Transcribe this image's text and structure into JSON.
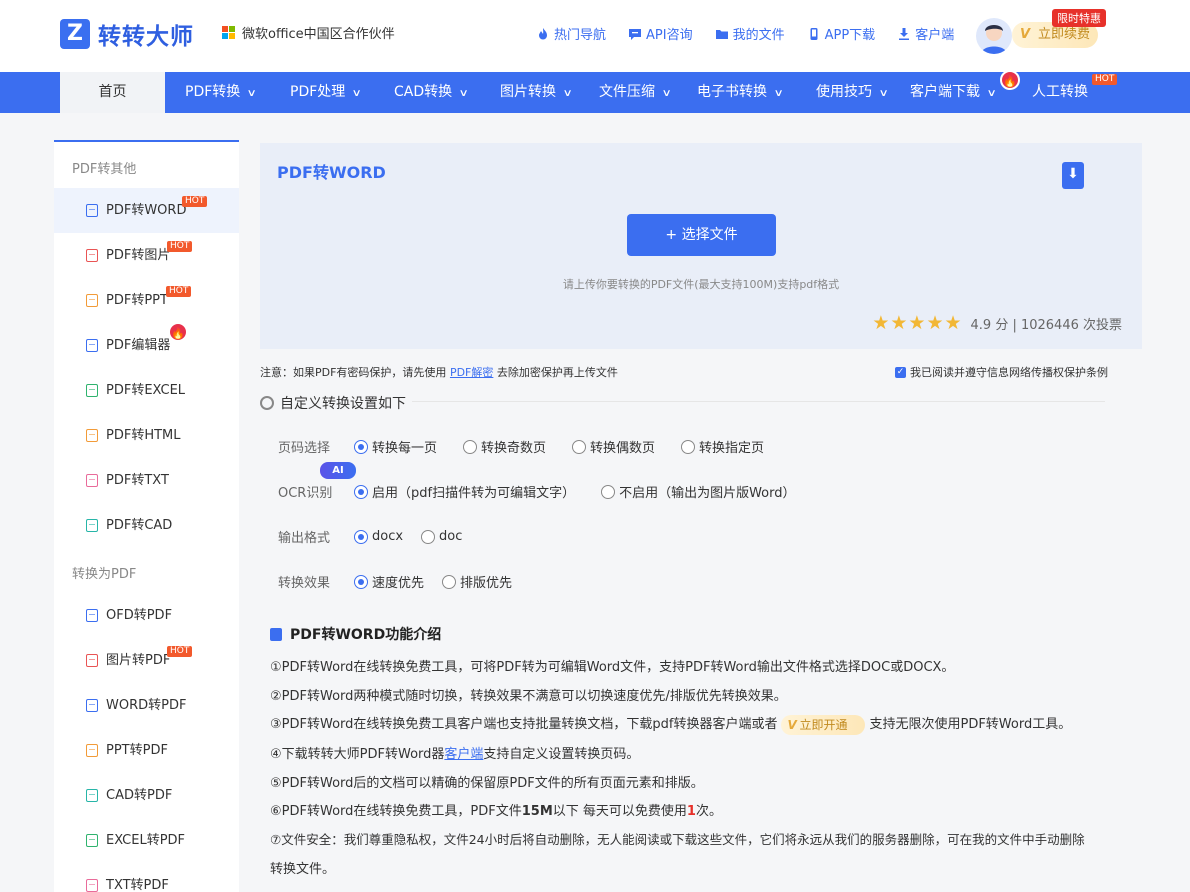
{
  "header": {
    "logo_text": "转转大师",
    "logo_mark": "Z",
    "partner_text": "微软office中国区合作伙伴",
    "links": [
      {
        "label": "热门导航",
        "icon": "fire-icon"
      },
      {
        "label": "API咨询",
        "icon": "chat-icon"
      },
      {
        "label": "我的文件",
        "icon": "folder-icon"
      },
      {
        "label": "APP下载",
        "icon": "phone-icon"
      },
      {
        "label": "客户端",
        "icon": "download-icon"
      }
    ],
    "renew_label": "立即续费",
    "limit_badge": "限时特惠"
  },
  "nav": {
    "home": "首页",
    "items": [
      {
        "label": "PDF转换"
      },
      {
        "label": "PDF处理"
      },
      {
        "label": "CAD转换"
      },
      {
        "label": "图片转换"
      },
      {
        "label": "文件压缩"
      },
      {
        "label": "电子书转换"
      },
      {
        "label": "使用技巧"
      },
      {
        "label": "客户端下载"
      },
      {
        "label": "人工转换"
      }
    ],
    "hot": "HOT"
  },
  "sidebar": {
    "group1": "PDF转其他",
    "group2": "转换为PDF",
    "items1": [
      {
        "label": "PDF转WORD",
        "badge": "HOT"
      },
      {
        "label": "PDF转图片",
        "badge": "HOT"
      },
      {
        "label": "PDF转PPT",
        "badge": "HOT"
      },
      {
        "label": "PDF编辑器",
        "badge": ""
      },
      {
        "label": "PDF转EXCEL",
        "badge": ""
      },
      {
        "label": "PDF转HTML",
        "badge": ""
      },
      {
        "label": "PDF转TXT",
        "badge": ""
      },
      {
        "label": "PDF转CAD",
        "badge": ""
      }
    ],
    "items2": [
      {
        "label": "OFD转PDF",
        "badge": ""
      },
      {
        "label": "图片转PDF",
        "badge": "HOT"
      },
      {
        "label": "WORD转PDF",
        "badge": ""
      },
      {
        "label": "PPT转PDF",
        "badge": ""
      },
      {
        "label": "CAD转PDF",
        "badge": ""
      },
      {
        "label": "EXCEL转PDF",
        "badge": ""
      },
      {
        "label": "TXT转PDF",
        "badge": ""
      }
    ]
  },
  "upload": {
    "title": "PDF转WORD",
    "choose_label": "+ 选择文件",
    "hint": "请上传你要转换的PDF文件(最大支持100M)支持pdf格式",
    "stars": "★★★★★",
    "score": "4.9 分 | 1026446 次投票",
    "rating_value": 4.9
  },
  "note": {
    "prefix": "注意：如果PDF有密码保护，请先使用",
    "link": "PDF解密",
    "suffix": "去除加密保护再上传文件",
    "agree": "我已阅读并遵守信息网络传播权保护条例",
    "agree_checked": true
  },
  "settings": {
    "title": "自定义转换设置如下",
    "rows": [
      {
        "label": "页码选择",
        "options": [
          "转换每一页",
          "转换奇数页",
          "转换偶数页",
          "转换指定页"
        ],
        "selected": 0
      },
      {
        "label": "OCR识别",
        "options": [
          "启用（pdf扫描件转为可编辑文字）",
          "不启用（输出为图片版Word）"
        ],
        "selected": 0
      },
      {
        "label": "输出格式",
        "options": [
          "docx",
          "doc"
        ],
        "selected": 0
      },
      {
        "label": "转换效果",
        "options": [
          "速度优先",
          "排版优先"
        ],
        "selected": 0
      }
    ],
    "ai_badge": "AI"
  },
  "intro": {
    "title": "PDF转WORD功能介绍",
    "l1": "①PDF转Word在线转换免费工具，可将PDF转为可编辑Word文件，支持PDF转Word输出文件格式选择DOC或DOCX。",
    "l2": "②PDF转Word两种模式随时切换，转换效果不满意可以切换速度优先/排版优先转换效果。",
    "l3a": "③PDF转Word在线转换免费工具客户端也支持批量转换文档，下载pdf转换器客户端或者",
    "l3btn": "立即开通",
    "l3b": "支持无限次使用PDF转Word工具。",
    "l4a": "④下载转转大师PDF转Word器",
    "l4link": "客户端",
    "l4b": "支持自定义设置转换页码。",
    "l5": "⑤PDF转Word后的文档可以精确的保留原PDF文件的所有页面元素和排版。",
    "l6a": "⑥PDF转Word在线转换免费工具，PDF文件",
    "l6b": "15M",
    "l6c": "以下 每天可以免费使用",
    "l6d": "1",
    "l6e": "次。",
    "l7": "⑦文件安全：我们尊重隐私权，文件24小时后将自动删除，无人能阅读或下载这些文件，它们将永远从我们的服务器删除，可在我的文件中手动删除",
    "l8": "转换文件。"
  },
  "colors": {
    "accent": "#3b6ef0",
    "hot": "#f2592c",
    "star": "#f2b735"
  }
}
